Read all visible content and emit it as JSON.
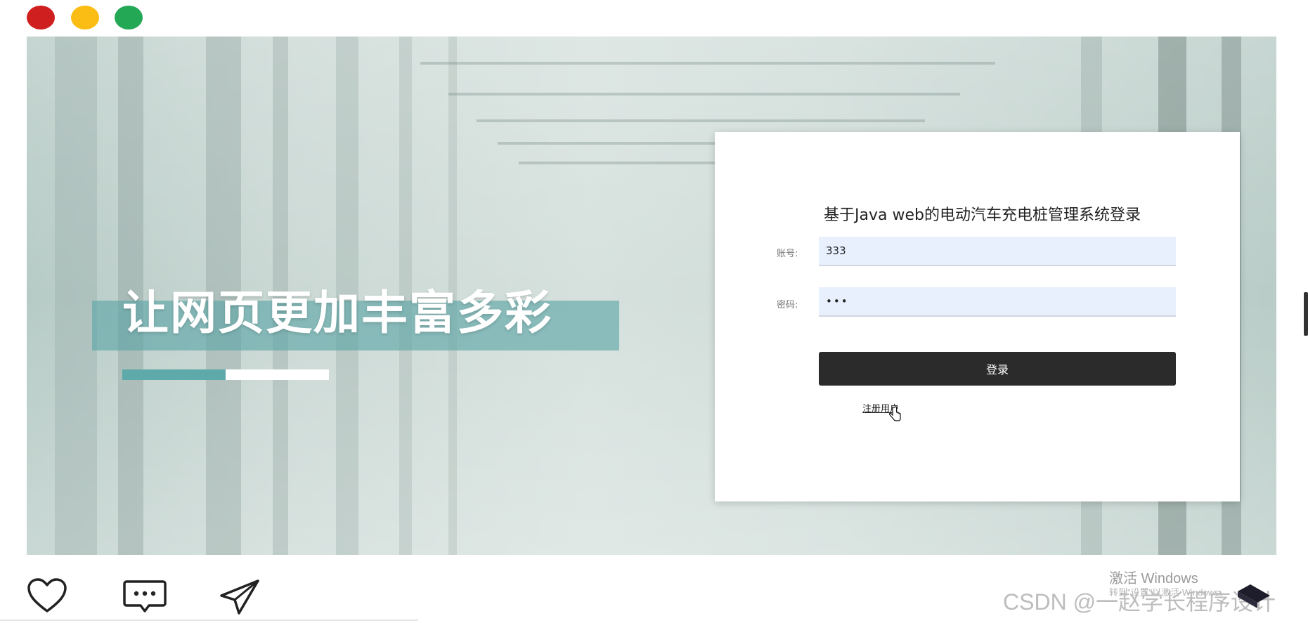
{
  "window": {
    "dots": [
      "close",
      "minimize",
      "maximize"
    ]
  },
  "hero": {
    "slogan": "让网页更加丰富多彩"
  },
  "login": {
    "title": "基于Java web的电动汽车充电桩管理系统登录",
    "account_label": "账号:",
    "account_value": "333",
    "password_label": "密码:",
    "password_value": "•••",
    "login_button": "登录",
    "register_link": "注册用户"
  },
  "bottom_bar": {
    "icons": [
      "heart-icon",
      "message-icon",
      "send-icon"
    ]
  },
  "watermark": {
    "activate": "激活 Windows",
    "activate_sub": "转到\"设置\"以激活 Windows。",
    "csdn": "CSDN @一赵学长程序设计"
  },
  "colors": {
    "dot_red": "#cf1f1f",
    "dot_yellow": "#fbbd14",
    "dot_green": "#23a856",
    "accent_teal": "#5ea9aa",
    "button_dark": "#2b2b2b",
    "input_bg": "#e8f0fe"
  }
}
